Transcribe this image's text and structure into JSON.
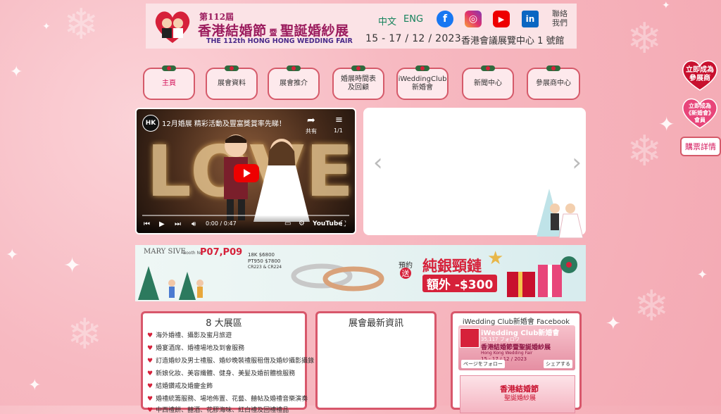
{
  "header": {
    "edition": "第112屆",
    "title_main": "香港結婚節",
    "title_conj": "暨",
    "title_sub": "聖誕婚紗展",
    "title_en": "THE 112th HONG HONG WEDDING FAIR",
    "lang_zh": "中文",
    "lang_en": "ENG",
    "contact": "聯絡\n我們",
    "dates": "15 - 17 / 12 / 2023",
    "venue": "香港會議展覽中心 1 號館"
  },
  "nav": [
    "主頁",
    "展會資料",
    "展會推介",
    "婚展時間表\n及回顧",
    "iWeddingClub\n新婚會",
    "新聞中心",
    "參展商中心"
  ],
  "side": {
    "exhibitor": "立即成為\n參展商",
    "member": "立即成為\n《新婚會》\n會員",
    "tickets": "購票詳情"
  },
  "video": {
    "channel": "HK",
    "title": "12月婚展 精彩活動及豐富獎賞率先睇！",
    "share": "共有",
    "count": "1/1",
    "time": "0:00 / 0:47",
    "brand": "YouTube"
  },
  "banner": {
    "brand": "MARY SIVE",
    "booth_label": "Booth No.",
    "booth": "P07,P09",
    "price1": "18K  $6800",
    "price2": "PT950  $7800",
    "codes": "CR223 & CR224",
    "promo1": "預約",
    "promo2": "送",
    "headline": "純銀頸鏈",
    "extra": "額外 -$300"
  },
  "zones": {
    "title": "8 大展區",
    "items": [
      "海外婚禮、攝影及蜜月旅遊",
      "婚宴酒席、婚禮場地及到會服務",
      "訂造婚紗及男士禮服、婚紗晚裝禮服租借及婚紗攝影攝錄",
      "新娘化妝、美容纖體、健身、美髮及婚前體檢服務",
      "結婚鑽戒及婚慶金飾",
      "婚禮統籌服務、場地佈置、花藝、囍帖及婚禮音樂演奏",
      "中西禮餅、囍酒、花膠海味、紅白禮及回禮禮品"
    ]
  },
  "news": {
    "title": "展會最新資訊"
  },
  "facebook": {
    "title": "iWedding Club新婚會 Facebook",
    "page": "iWedding Club新婚會",
    "followers": "35,117 フォロワ",
    "fair": "香港結婚節暨聖誕婚紗展",
    "fair_en": "Hong Kong Wedding Fair",
    "dates": "15 - 17 / 12 / 2023",
    "follow": "ページをフォロー",
    "share": "シェアする"
  },
  "colors": {
    "accent": "#d55a6a",
    "bg": "#f7b9c1",
    "green": "#15825b",
    "red": "#d6213a"
  }
}
